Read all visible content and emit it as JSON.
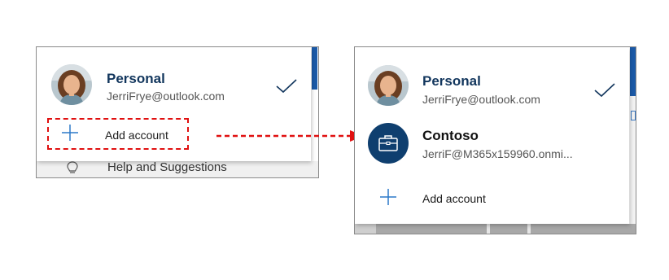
{
  "left_panel": {
    "account": {
      "name": "Personal",
      "email": "JerriFrye@outlook.com",
      "selected": true
    },
    "add_account_label": "Add account",
    "underlying_item_label": "Help and Suggestions"
  },
  "right_panel": {
    "accounts": [
      {
        "name": "Personal",
        "email": "JerriFrye@outlook.com",
        "selected": true,
        "avatar": "photo"
      },
      {
        "name": "Contoso",
        "email": "JerriF@M365x159960.onmi...",
        "selected": false,
        "avatar": "briefcase-icon"
      }
    ],
    "add_account_label": "Add account"
  },
  "colors": {
    "accent_blue": "#1b5aa8",
    "title_navy": "#12365d",
    "work_avatar": "#0f3f6f",
    "plus_blue": "#2b79c9",
    "annotation_red": "#e01010"
  },
  "icons": [
    "check-icon",
    "plus-icon",
    "briefcase-icon",
    "lightbulb-icon",
    "arrow-icon"
  ]
}
